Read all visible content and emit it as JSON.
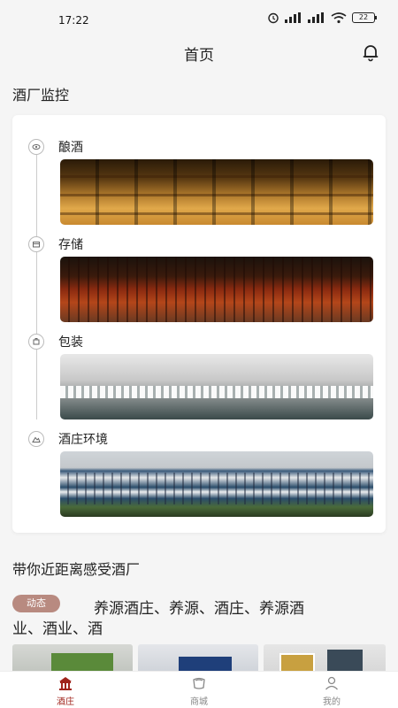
{
  "status_bar": {
    "time": "17:22",
    "battery": "22"
  },
  "header": {
    "title": "首页"
  },
  "monitor": {
    "title": "酒厂监控",
    "stages": [
      {
        "label": "酿酒",
        "icon": "eye-icon"
      },
      {
        "label": "存储",
        "icon": "box-icon"
      },
      {
        "label": "包装",
        "icon": "package-icon"
      },
      {
        "label": "酒庄环境",
        "icon": "landscape-icon"
      }
    ]
  },
  "promo": {
    "title": "带你近距离感受酒厂",
    "tag": "动态",
    "text_line1": "养源酒庄、养源、酒庄、养源酒",
    "text_line2": "业、酒业、酒"
  },
  "tabs": [
    {
      "label": "酒庄",
      "icon": "winery-icon",
      "active": true
    },
    {
      "label": "商城",
      "icon": "shop-icon",
      "active": false
    },
    {
      "label": "我的",
      "icon": "user-icon",
      "active": false
    }
  ],
  "colors": {
    "accent": "#a0241c",
    "tag_bg": "#b88a80",
    "background": "#f5f5f5"
  }
}
